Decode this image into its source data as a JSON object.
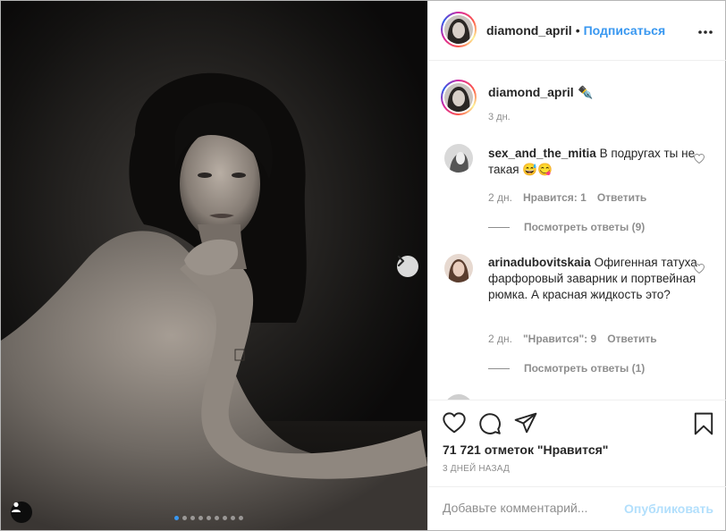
{
  "post": {
    "author": "diamond_april",
    "follow_separator": "•",
    "follow_label": "Подписаться",
    "more_icon": "more-horizontal-icon"
  },
  "caption": {
    "username": "diamond_april",
    "emoji": "✒️",
    "time": "3 дн."
  },
  "comments": [
    {
      "username": "sex_and_the_mitia",
      "text": "В подругах ты не такая 😅😋",
      "time": "2 дн.",
      "likes": "Нравится: 1",
      "reply": "Ответить",
      "view_replies": "Посмотреть ответы (9)"
    },
    {
      "username": "arinadubovitskaia",
      "text": "Офигенная татуха фарфоровый заварник и портвейная рюмка. А красная жидкость это?",
      "time": "2 дн.",
      "likes": "\"Нравится\": 9",
      "reply": "Ответить",
      "view_replies": "Посмотреть ответы (1)"
    }
  ],
  "actions": {
    "likes_text": "71 721 отметок \"Нравится\"",
    "date_text": "3 ДНЕЙ НАЗАД"
  },
  "composer": {
    "placeholder": "Добавьте комментарий...",
    "post_label": "Опубликовать"
  },
  "carousel": {
    "slide_count": 9,
    "active_index": 0
  },
  "colors": {
    "accent": "#3897f0",
    "text": "#262626",
    "muted": "#8e8e8e",
    "post_disabled": "#b2dffc"
  }
}
